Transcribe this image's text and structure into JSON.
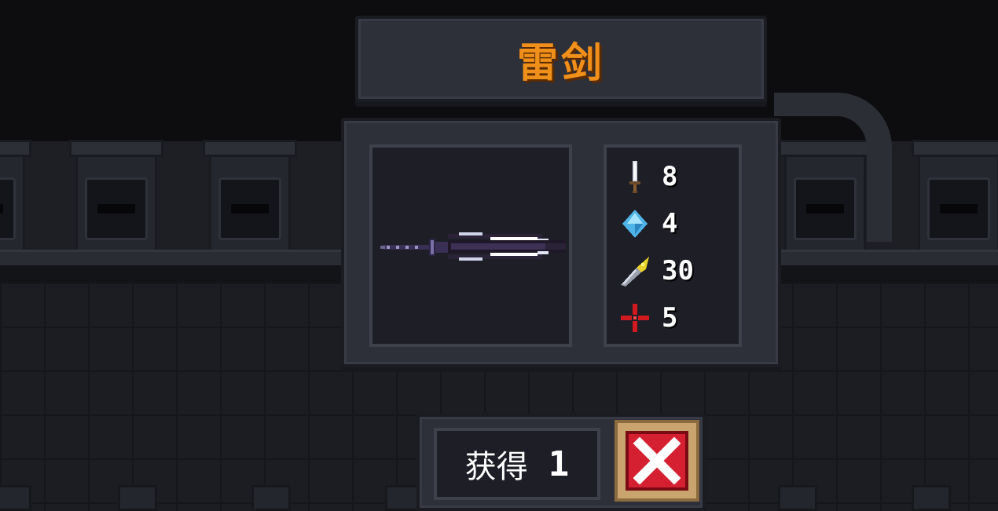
{
  "item": {
    "name": "雷剑",
    "sprite": "thunder-sword-sprite"
  },
  "stats": [
    {
      "icon": "sword-icon",
      "stat": "attack",
      "value": "8"
    },
    {
      "icon": "crystal-icon",
      "stat": "energy",
      "value": "4"
    },
    {
      "icon": "feather-dart-icon",
      "stat": "critical",
      "value": "30"
    },
    {
      "icon": "crosshair-icon",
      "stat": "accuracy",
      "value": "5"
    }
  ],
  "obtain": {
    "label": "获得",
    "count": "1"
  },
  "close_button": {
    "icon": "close-x-icon"
  },
  "colors": {
    "title": "#f0901a",
    "panel": "#2d2f39",
    "inner": "#1d1e26",
    "close_red": "#d42030",
    "close_frame": "#c9a46e"
  }
}
